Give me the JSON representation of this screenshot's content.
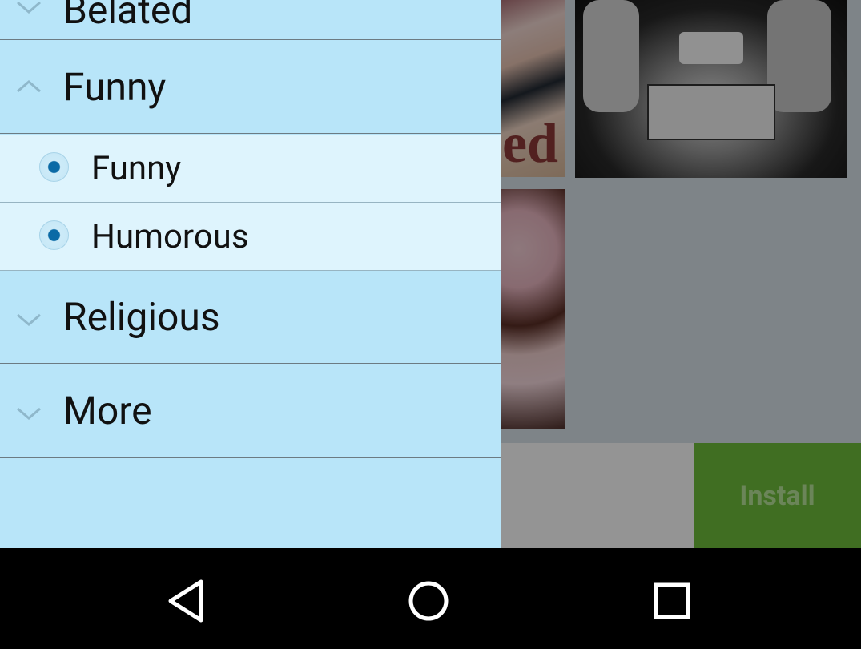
{
  "drawer": {
    "top_partial_label": "Belated",
    "groups": [
      {
        "label": "Funny",
        "expanded": true,
        "icon": "chevron-up-icon"
      },
      {
        "label": "Religious",
        "expanded": false,
        "icon": "chevron-down-icon"
      },
      {
        "label": "More",
        "expanded": false,
        "icon": "chevron-down-icon"
      }
    ],
    "funny_children": [
      {
        "label": "Funny",
        "selected": true
      },
      {
        "label": "Humorous",
        "selected": true
      }
    ]
  },
  "background": {
    "card_text": "ced",
    "ad_button_label": "Install"
  },
  "navbar": {
    "back_icon": "back-triangle-icon",
    "home_icon": "home-circle-icon",
    "recents_icon": "recents-square-icon"
  },
  "colors": {
    "drawer_bg": "#b8e5f9",
    "child_bg": "#def4fd",
    "radio_accent": "#0a6aa6",
    "install_green": "#6fbe3b"
  }
}
